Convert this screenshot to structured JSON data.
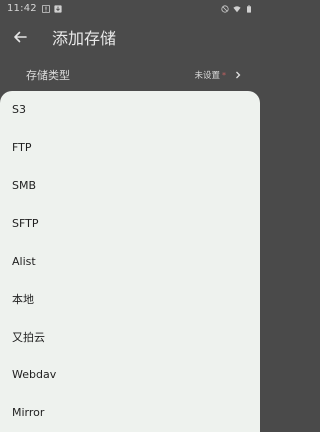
{
  "status": {
    "time": "11:42",
    "left_icons": [
      "alert-icon",
      "download-icon"
    ],
    "right_icons": [
      "do-not-disturb-icon",
      "wifi-icon",
      "battery-icon"
    ]
  },
  "appbar": {
    "back_icon": "arrow-back-icon",
    "title": "添加存储"
  },
  "form": {
    "storage_type_label": "存储类型",
    "storage_type_value": "未设置",
    "required_mark": "*"
  },
  "sheet": {
    "options": [
      "S3",
      "FTP",
      "SMB",
      "SFTP",
      "Alist",
      "本地",
      "又拍云",
      "Webdav",
      "Mirror"
    ]
  },
  "colors": {
    "scrim_background": "#4b4b4b",
    "sheet_background": "#eef2ee",
    "required_color": "#c06060"
  }
}
